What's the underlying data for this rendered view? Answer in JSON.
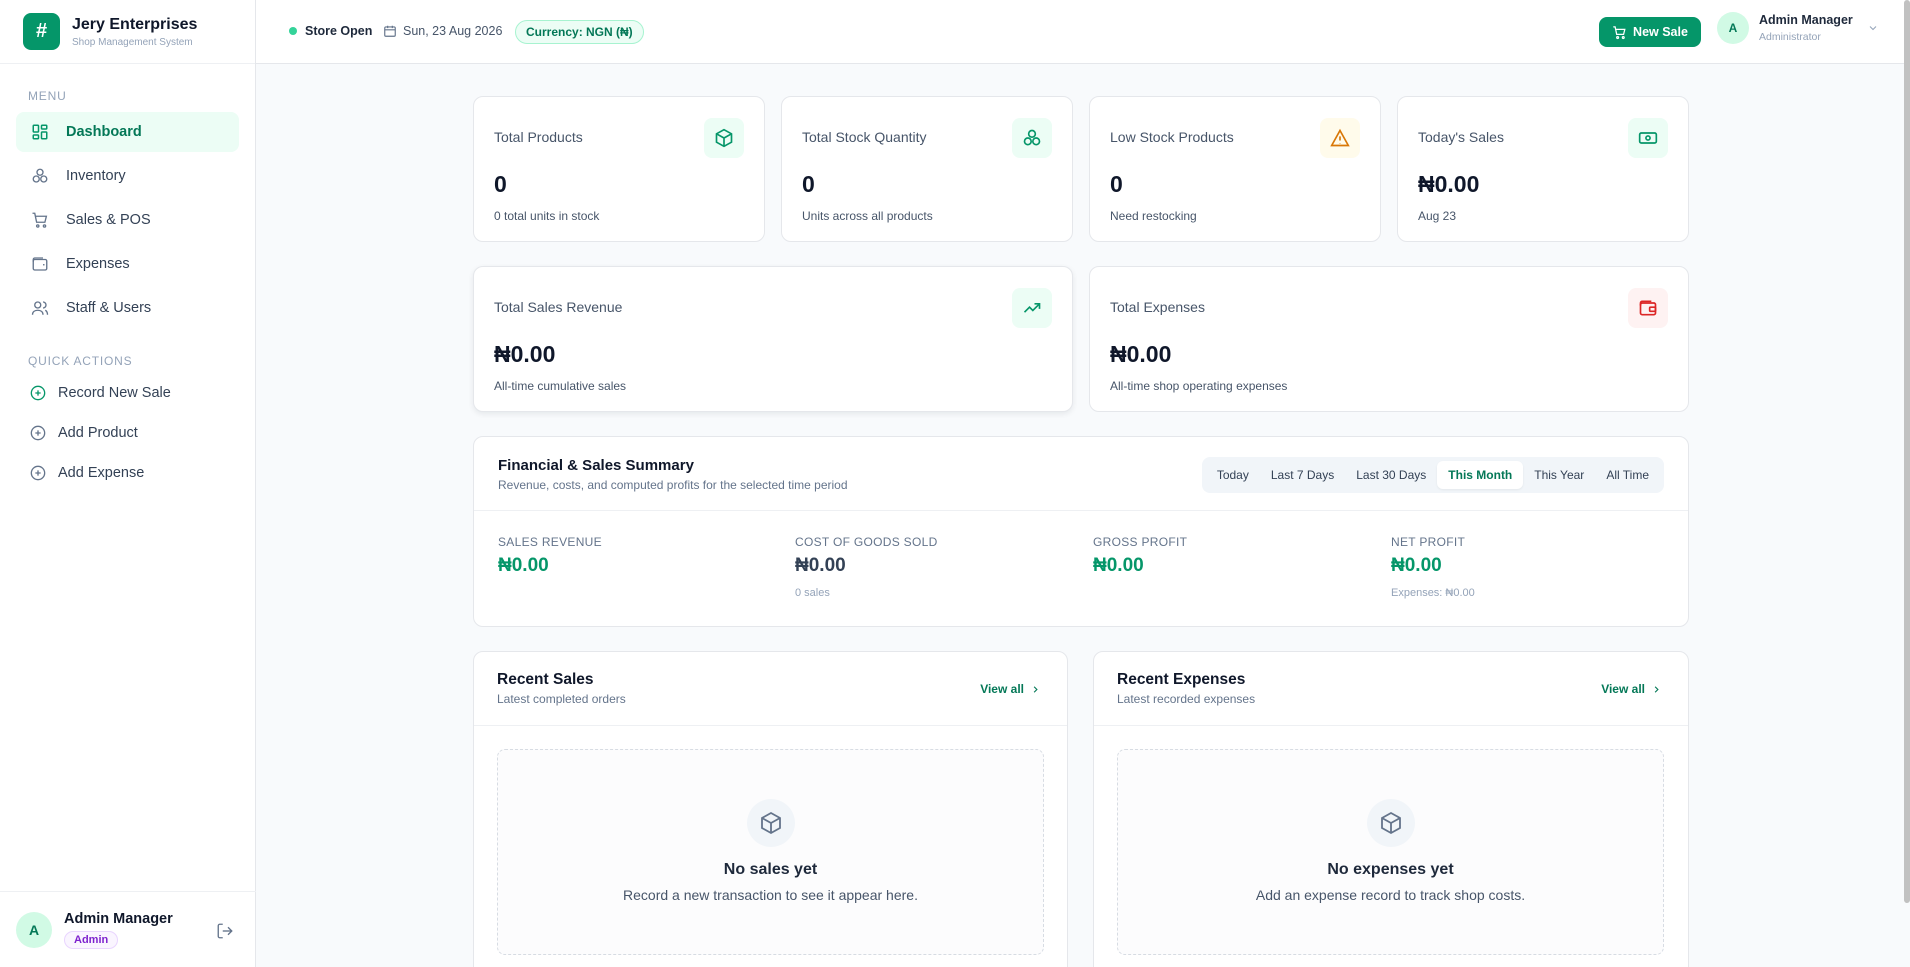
{
  "brand": {
    "name": "Jery Enterprises",
    "subtitle": "Shop Management System",
    "logo_glyph": "#"
  },
  "sidebar": {
    "menu_label": "MENU",
    "items": [
      {
        "label": "Dashboard",
        "icon": "layout-grid-icon",
        "active": true
      },
      {
        "label": "Inventory",
        "icon": "boxes-icon"
      },
      {
        "label": "Sales & POS",
        "icon": "cart-icon"
      },
      {
        "label": "Expenses",
        "icon": "wallet-icon"
      },
      {
        "label": "Staff & Users",
        "icon": "users-icon"
      }
    ],
    "quick_label": "QUICK ACTIONS",
    "quick_actions": [
      {
        "label": "Record New Sale",
        "icon": "plus-circle-icon"
      },
      {
        "label": "Add Product",
        "icon": "plus-circle-icon"
      },
      {
        "label": "Add Expense",
        "icon": "plus-circle-icon"
      }
    ],
    "footer": {
      "avatar": "A",
      "name": "Admin Manager",
      "role": "Admin"
    }
  },
  "header": {
    "store_status": "Store Open",
    "date": "Sun, 23 Aug 2026",
    "currency": "Currency: NGN (₦)",
    "new_sale_label": "New Sale",
    "user": {
      "avatar": "A",
      "name": "Admin Manager",
      "role": "Administrator"
    }
  },
  "stats": [
    {
      "title": "Total Products",
      "value": "0",
      "sub": "0 total units in stock",
      "icon": "package-icon"
    },
    {
      "title": "Total Stock Quantity",
      "value": "0",
      "sub": "Units across all products",
      "icon": "boxes-icon"
    },
    {
      "title": "Low Stock Products",
      "value": "0",
      "sub": "Need restocking",
      "icon": "warning-icon"
    },
    {
      "title": "Today's Sales",
      "value": "₦0.00",
      "sub": "Aug 23",
      "icon": "banknote-icon"
    },
    {
      "title": "Total Sales Revenue",
      "value": "₦0.00",
      "sub": "All-time cumulative sales",
      "icon": "trending-up-icon"
    },
    {
      "title": "Total Expenses",
      "value": "₦0.00",
      "sub": "All-time shop operating expenses",
      "icon": "wallet-icon"
    }
  ],
  "financial": {
    "title": "Financial & Sales Summary",
    "subtitle": "Revenue, costs, and computed profits for the selected time period",
    "tabs": [
      "Today",
      "Last 7 Days",
      "Last 30 Days",
      "This Month",
      "This Year",
      "All Time"
    ],
    "active_tab": "This Month",
    "metrics": [
      {
        "label": "SALES REVENUE",
        "value": "₦0.00",
        "note": ""
      },
      {
        "label": "COST OF GOODS SOLD",
        "value": "₦0.00",
        "note": "0 sales"
      },
      {
        "label": "GROSS PROFIT",
        "value": "₦0.00",
        "note": ""
      },
      {
        "label": "NET PROFIT",
        "value": "₦0.00",
        "note": "Expenses: ₦0.00"
      }
    ]
  },
  "recent_sales": {
    "title": "Recent Sales",
    "subtitle": "Latest completed orders",
    "view_all": "View all",
    "empty_title": "No sales yet",
    "empty_sub": "Record a new transaction to see it appear here."
  },
  "recent_expenses": {
    "title": "Recent Expenses",
    "subtitle": "Latest recorded expenses",
    "view_all": "View all",
    "empty_title": "No expenses yet",
    "empty_sub": "Add an expense record to track shop costs."
  },
  "colors": {
    "accent": "#059669",
    "accent_light": "#ecfdf5",
    "danger": "#dc2626",
    "warning": "#d97706"
  }
}
